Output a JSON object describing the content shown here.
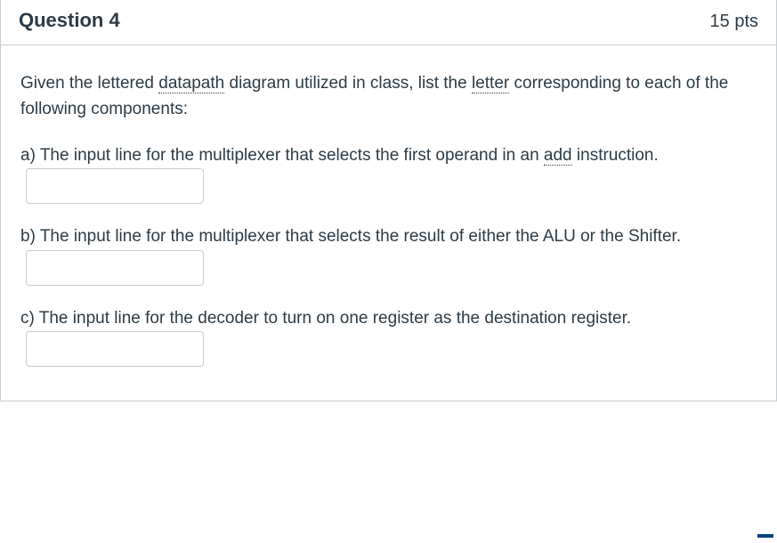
{
  "header": {
    "title": "Question 4",
    "points": "15 pts"
  },
  "stem": {
    "pre1": "Given the lettered ",
    "link1": "datapath",
    "mid1": " diagram utilized in class, list the ",
    "link2": "letter",
    "post1": " corresponding to each of the following components:"
  },
  "parts": {
    "a": {
      "pre": "a) The input line for the multiplexer that selects the first operand in an ",
      "link": "add",
      "post": " instruction."
    },
    "b": {
      "text": "b) The input line for the multiplexer that selects the result of either the ALU or the Shifter."
    },
    "c": {
      "text": "c) The input line for the decoder to turn on one register as the destination register."
    }
  },
  "inputs": {
    "a_value": "",
    "b_value": "",
    "c_value": ""
  }
}
